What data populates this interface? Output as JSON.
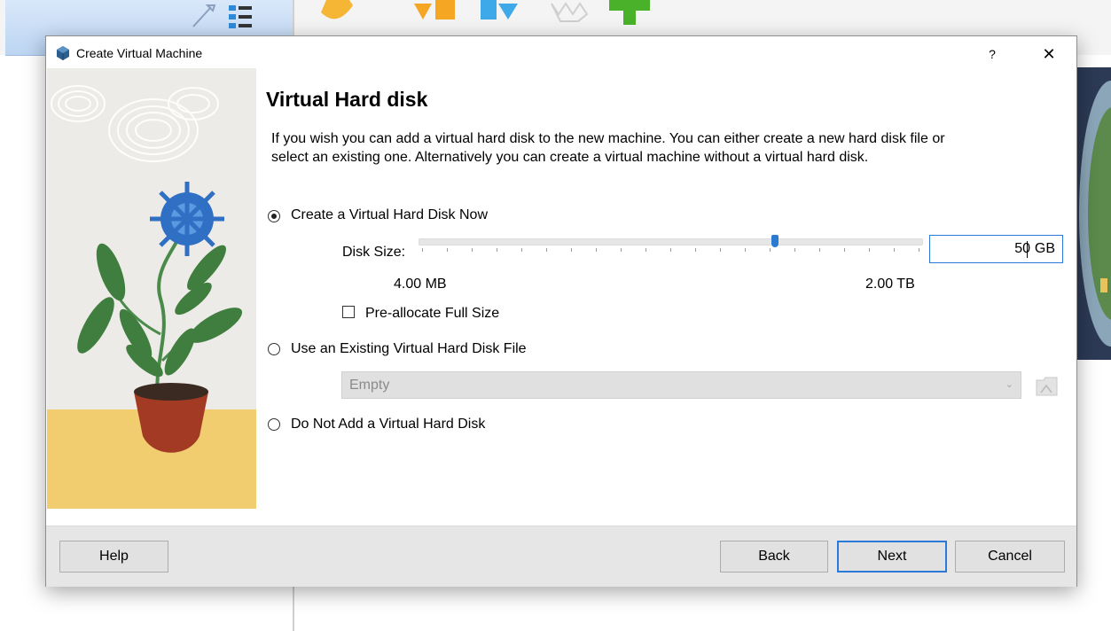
{
  "dialog": {
    "title": "Create Virtual Machine",
    "help_glyph": "?",
    "close_glyph": "✕"
  },
  "page": {
    "heading": "Virtual Hard disk",
    "description": "If you wish you can add a virtual hard disk to the new machine. You can either create a new hard disk file or select an existing one. Alternatively you can create a virtual machine without a virtual hard disk."
  },
  "options": {
    "create_new": {
      "label": "Create a Virtual Hard Disk Now",
      "selected": true
    },
    "use_existing": {
      "label": "Use an Existing Virtual Hard Disk File",
      "selected": false
    },
    "no_disk": {
      "label": "Do Not Add a Virtual Hard Disk",
      "selected": false
    }
  },
  "disk_size": {
    "label": "Disk Size:",
    "min_label": "4.00 MB",
    "max_label": "2.00 TB",
    "value": "50",
    "unit": "GB",
    "slider_fraction": 0.71
  },
  "preallocate": {
    "label": "Pre-allocate Full Size",
    "checked": false
  },
  "existing_file": {
    "value": "Empty"
  },
  "buttons": {
    "help": "Help",
    "back": "Back",
    "next": "Next",
    "cancel": "Cancel"
  },
  "colors": {
    "accent": "#2b79d8",
    "footer": "#e6e6e6",
    "disabled_field": "#e0e0e0"
  }
}
